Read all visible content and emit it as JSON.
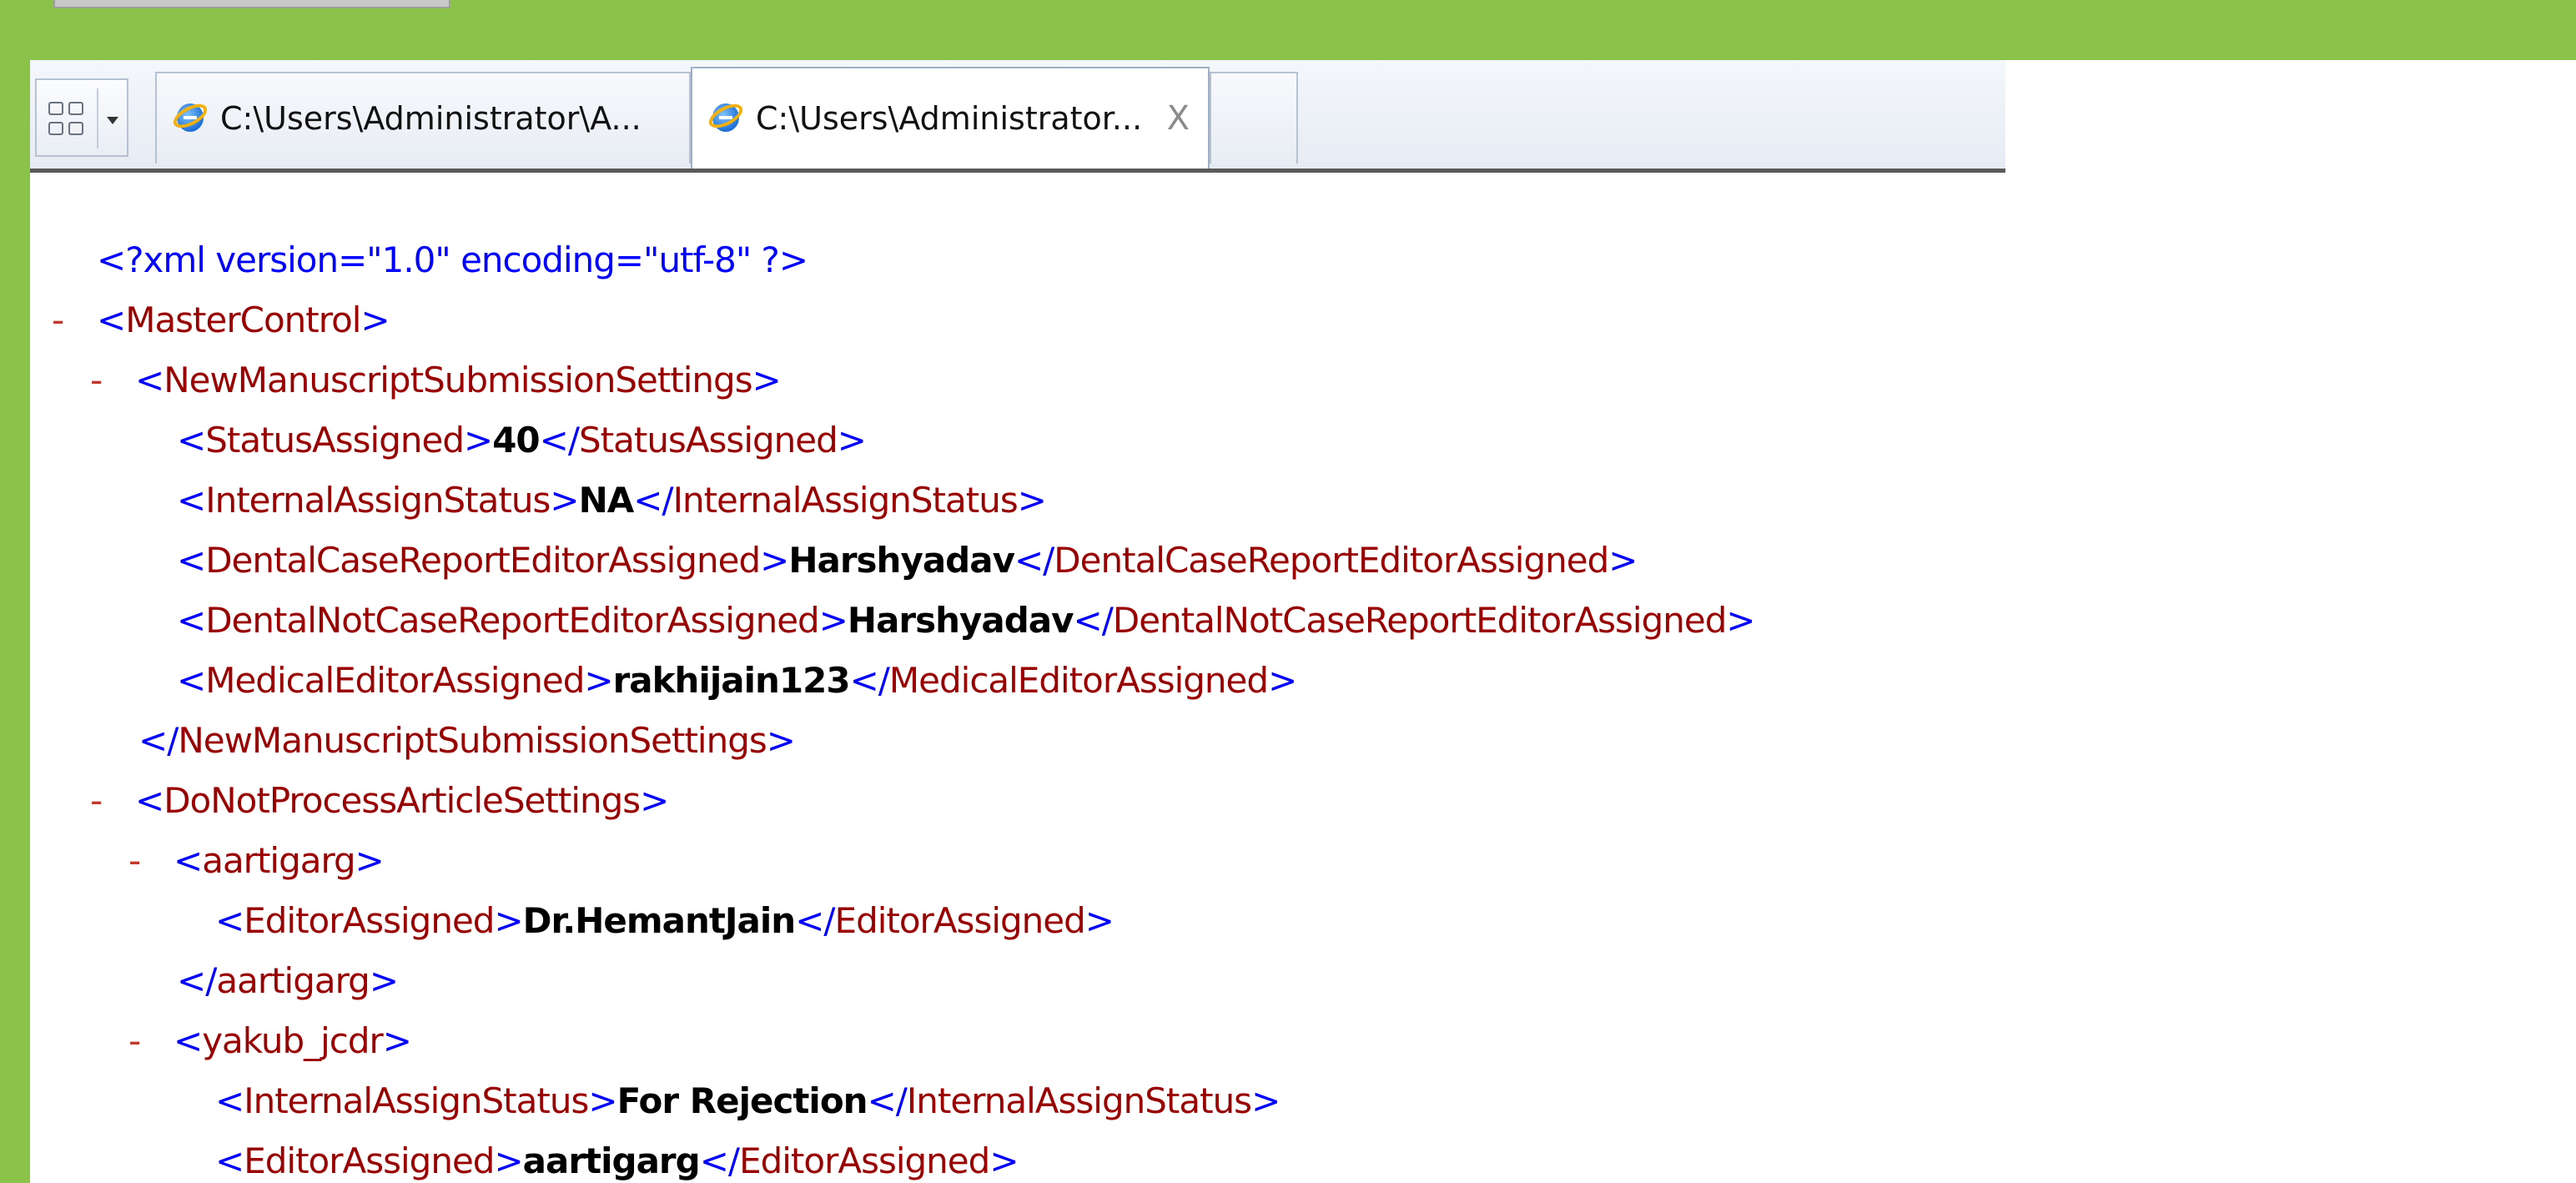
{
  "tabs": [
    {
      "label": "C:\\Users\\Administrator\\A...",
      "active": false
    },
    {
      "label": "C:\\Users\\Administrator...",
      "active": true,
      "close": "X"
    },
    {
      "label": "",
      "active": false
    }
  ],
  "xml": {
    "declaration": "<?xml version=\"1.0\" encoding=\"utf-8\" ?>",
    "collapse_symbol": "-",
    "lines": [
      {
        "open": "MasterControl",
        "collapsible": true
      },
      {
        "open": "NewManuscriptSubmissionSettings",
        "collapsible": true
      },
      {
        "tag": "StatusAssigned",
        "value": "40"
      },
      {
        "tag": "InternalAssignStatus",
        "value": "NA"
      },
      {
        "tag": "DentalCaseReportEditorAssigned",
        "value": "Harshyadav"
      },
      {
        "tag": "DentalNotCaseReportEditorAssigned",
        "value": "Harshyadav"
      },
      {
        "tag": "MedicalEditorAssigned",
        "value": "rakhijain123"
      },
      {
        "close": "NewManuscriptSubmissionSettings"
      },
      {
        "open": "DoNotProcessArticleSettings",
        "collapsible": true
      },
      {
        "open": "aartigarg",
        "collapsible": true
      },
      {
        "tag": "EditorAssigned",
        "value": "Dr.HemantJain"
      },
      {
        "close": "aartigarg"
      },
      {
        "open": "yakub_jcdr",
        "collapsible": true
      },
      {
        "tag": "InternalAssignStatus",
        "value": "For Rejection"
      },
      {
        "tag": "EditorAssigned",
        "value": "aartigarg"
      }
    ]
  },
  "colors": {
    "frame": "#8bc34a",
    "bracket": "#0000ff",
    "tag": "#990000",
    "collapse": "#c0392b"
  }
}
